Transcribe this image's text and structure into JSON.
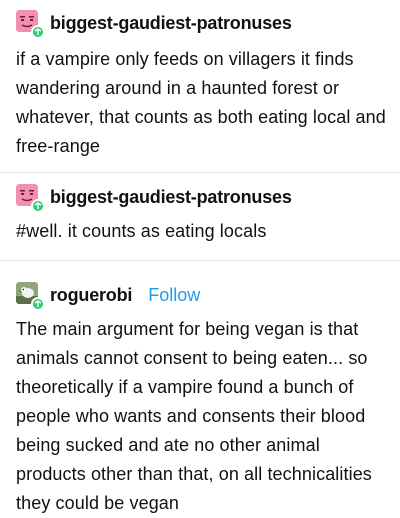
{
  "posts": [
    {
      "username": "biggest-gaudiest-patronuses",
      "avatar_icon": "pink-face-avatar",
      "badge_icon": "reblog-icon",
      "text": "if a vampire only feeds on villagers it finds wandering around in a haunted forest or whatever, that counts as both eating local and free-range"
    },
    {
      "username": "biggest-gaudiest-patronuses",
      "avatar_icon": "pink-face-avatar",
      "badge_icon": "reblog-icon",
      "text": "#well. it counts as eating locals"
    },
    {
      "username": "roguerobi",
      "avatar_icon": "bird-photo-avatar",
      "badge_icon": "reblog-icon",
      "follow_label": "Follow",
      "text": "The main argument for being vegan is that animals cannot consent to being eaten... so theoretically if a vampire found a bunch of people who wants and consents their blood being sucked and ate no other animal products other than that, on all technicalities they could be vegan"
    }
  ],
  "colors": {
    "follow": "#1e9be9",
    "reblog_badge": "#2ecc71",
    "avatar_pink": "#f48fb1"
  }
}
